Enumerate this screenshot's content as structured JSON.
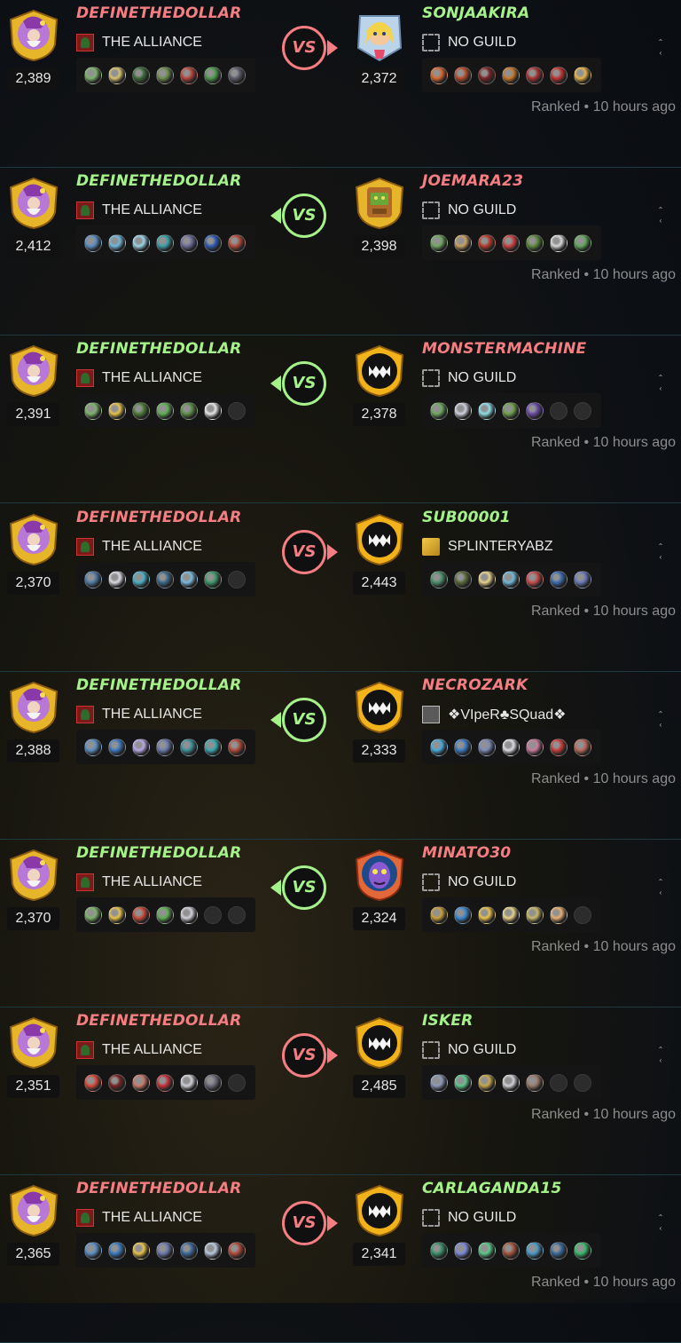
{
  "colors": {
    "win": "#a6f28a",
    "lose": "#f47e82"
  },
  "battles": [
    {
      "vs_label": "VS",
      "winner": "right",
      "left": {
        "name": "DEFINETHEDOLLAR",
        "result": "lose",
        "guild": "THE ALLIANCE",
        "guild_icon": "alliance",
        "rating": "2,389",
        "avatar": "wizard",
        "team": [
          "#7db36b",
          "#d8c070",
          "#3d6b3a",
          "#6b8f4c",
          "#b9443a",
          "#4c9a4a",
          "#5c5c6a"
        ]
      },
      "right": {
        "name": "SONJAAKIRA",
        "result": "win",
        "guild": "NO GUILD",
        "guild_icon": "none",
        "rating": "2,372",
        "avatar": "blonde",
        "team": [
          "#d9662c",
          "#b84a2a",
          "#7a2222",
          "#c9782a",
          "#a83232",
          "#c43030",
          "#e5b54a"
        ]
      },
      "meta": "Ranked • 10 hours ago"
    },
    {
      "vs_label": "VS",
      "winner": "left",
      "left": {
        "name": "DEFINETHEDOLLAR",
        "result": "win",
        "guild": "THE ALLIANCE",
        "guild_icon": "alliance",
        "rating": "2,412",
        "avatar": "wizard",
        "team": [
          "#5a8fc4",
          "#6fb8e0",
          "#9ad4e8",
          "#3a9fa8",
          "#6b6b9a",
          "#2f5bb5",
          "#b04a3a"
        ]
      },
      "right": {
        "name": "JOEMARA23",
        "result": "lose",
        "guild": "NO GUILD",
        "guild_icon": "none",
        "rating": "2,398",
        "avatar": "goblin",
        "team": [
          "#6fa860",
          "#c9a060",
          "#b73a2a",
          "#cc4040",
          "#5f8a3e",
          "#d8d8d8",
          "#62a85c"
        ]
      },
      "meta": "Ranked • 10 hours ago"
    },
    {
      "vs_label": "VS",
      "winner": "left",
      "left": {
        "name": "DEFINETHEDOLLAR",
        "result": "win",
        "guild": "THE ALLIANCE",
        "guild_icon": "alliance",
        "rating": "2,391",
        "avatar": "wizard",
        "team": [
          "#7db36b",
          "#e8c24a",
          "#4e7a38",
          "#5fae55",
          "#5c8f48",
          "#e6e6e6",
          "empty"
        ]
      },
      "right": {
        "name": "MONSTERMACHINE",
        "result": "lose",
        "guild": "NO GUILD",
        "guild_icon": "none",
        "rating": "2,378",
        "avatar": "monster",
        "team": [
          "#6fa860",
          "#d0d0e0",
          "#8ee0e8",
          "#6fa04a",
          "#6a4aa8",
          "empty",
          "empty"
        ]
      },
      "meta": "Ranked • 10 hours ago"
    },
    {
      "vs_label": "VS",
      "winner": "right",
      "left": {
        "name": "DEFINETHEDOLLAR",
        "result": "lose",
        "guild": "THE ALLIANCE",
        "guild_icon": "alliance",
        "rating": "2,370",
        "avatar": "wizard",
        "team": [
          "#4f7ba8",
          "#dcdce6",
          "#4ab0c8",
          "#3a6a8a",
          "#7ab8e0",
          "#3a9a6a",
          "empty"
        ]
      },
      "right": {
        "name": "SUB00001",
        "result": "win",
        "guild": "SPLINTERYABZ",
        "guild_icon": "gold",
        "rating": "2,443",
        "avatar": "monster",
        "team": [
          "#4a8f6a",
          "#5a6a3a",
          "#e8d28a",
          "#6fb8d8",
          "#c94a4a",
          "#3a6ab0",
          "#6a7ab8"
        ]
      },
      "meta": "Ranked • 10 hours ago"
    },
    {
      "vs_label": "VS",
      "winner": "left",
      "left": {
        "name": "DEFINETHEDOLLAR",
        "result": "win",
        "guild": "THE ALLIANCE",
        "guild_icon": "alliance",
        "rating": "2,388",
        "avatar": "wizard",
        "team": [
          "#5a8fc4",
          "#3a7ac0",
          "#b8a8e8",
          "#6a7ab0",
          "#3a8f9a",
          "#3aa8b0",
          "#b04a3a"
        ]
      },
      "right": {
        "name": "NECROZARK",
        "result": "lose",
        "guild": "❖VIpeR♣SQuad❖",
        "guild_icon": "skull",
        "rating": "2,333",
        "avatar": "monster",
        "team": [
          "#4aa8d8",
          "#3a7ac0",
          "#7a8ab8",
          "#dcdce6",
          "#c87a9a",
          "#c93a3a",
          "#b86a5a"
        ]
      },
      "meta": "Ranked • 10 hours ago"
    },
    {
      "vs_label": "VS",
      "winner": "left",
      "left": {
        "name": "DEFINETHEDOLLAR",
        "result": "win",
        "guild": "THE ALLIANCE",
        "guild_icon": "alliance",
        "rating": "2,370",
        "avatar": "wizard",
        "team": [
          "#7db36b",
          "#e8c24a",
          "#c94a3a",
          "#5fae55",
          "#d0d0d8",
          "empty",
          "empty"
        ]
      },
      "right": {
        "name": "MINATO30",
        "result": "lose",
        "guild": "NO GUILD",
        "guild_icon": "none",
        "rating": "2,324",
        "avatar": "alien",
        "team": [
          "#c8a03a",
          "#3a8ad0",
          "#e8c24a",
          "#e8d28a",
          "#c8b86a",
          "#e8b070",
          "empty"
        ]
      },
      "meta": "Ranked • 10 hours ago"
    },
    {
      "vs_label": "VS",
      "winner": "right",
      "left": {
        "name": "DEFINETHEDOLLAR",
        "result": "lose",
        "guild": "THE ALLIANCE",
        "guild_icon": "alliance",
        "rating": "2,351",
        "avatar": "wizard",
        "team": [
          "#d84a3a",
          "#7a2222",
          "#c97a6a",
          "#c9303a",
          "#d0d0d8",
          "#6a6a7a",
          "empty"
        ]
      },
      "right": {
        "name": "ISKER",
        "result": "win",
        "guild": "NO GUILD",
        "guild_icon": "none",
        "rating": "2,485",
        "avatar": "monster",
        "team": [
          "#8a9ab8",
          "#5ac88a",
          "#c8a84a",
          "#d0d0d8",
          "#9a7a6a",
          "empty",
          "empty"
        ]
      },
      "meta": "Ranked • 10 hours ago"
    },
    {
      "vs_label": "VS",
      "winner": "right",
      "left": {
        "name": "DEFINETHEDOLLAR",
        "result": "lose",
        "guild": "THE ALLIANCE",
        "guild_icon": "alliance",
        "rating": "2,365",
        "avatar": "wizard",
        "team": [
          "#5a8fc4",
          "#3a7ac0",
          "#e8c24a",
          "#6a7ab0",
          "#3a6a9a",
          "#b8c8e0",
          "#b04a3a"
        ]
      },
      "right": {
        "name": "CARLAGANDA15",
        "result": "win",
        "guild": "NO GUILD",
        "guild_icon": "none",
        "rating": "2,341",
        "avatar": "monster",
        "team": [
          "#3a8f6a",
          "#7a8ad8",
          "#5ac88a",
          "#a8533a",
          "#4a9ac8",
          "#3a6a9a",
          "#3ab86a"
        ]
      },
      "meta": "Ranked • 10 hours ago"
    }
  ]
}
